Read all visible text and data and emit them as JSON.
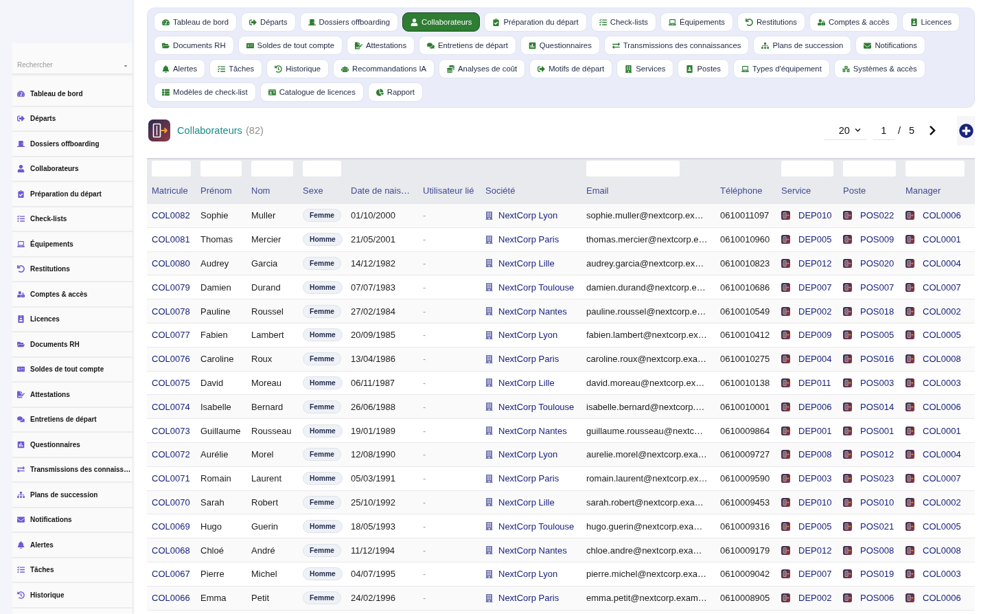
{
  "sidebar": {
    "search": {
      "placeholder": "Rechercher"
    },
    "items": [
      "Tableau de bord",
      "Départs",
      "Dossiers offboarding",
      "Collaborateurs",
      "Préparation du départ",
      "Check-lists",
      "Équipements",
      "Restitutions",
      "Comptes & accès",
      "Licences",
      "Documents RH",
      "Soldes de tout compte",
      "Attestations",
      "Entretiens de départ",
      "Questionnaires",
      "Transmissions des connaiss…",
      "Plans de succession",
      "Notifications",
      "Alertes",
      "Tâches",
      "Historique"
    ]
  },
  "tab_rows": [
    {
      "tabs": [
        {
          "label": "Tableau de bord",
          "selected": false
        },
        {
          "label": "Départs",
          "selected": false
        },
        {
          "label": "Dossiers offboarding",
          "selected": false
        },
        {
          "label": "Collaborateurs",
          "selected": true
        },
        {
          "label": "Préparation du départ",
          "selected": false
        },
        {
          "label": "Check-lists",
          "selected": false
        },
        {
          "label": "Équipements",
          "selected": false
        },
        {
          "label": "Restitutions",
          "selected": false
        },
        {
          "label": "Comptes & accès",
          "selected": false
        },
        {
          "label": "Licences",
          "selected": false
        }
      ]
    },
    {
      "tabs": [
        {
          "label": "Documents RH",
          "selected": false
        },
        {
          "label": "Soldes de tout compte",
          "selected": false
        },
        {
          "label": "Attestations",
          "selected": false
        },
        {
          "label": "Entretiens de départ",
          "selected": false
        },
        {
          "label": "Questionnaires",
          "selected": false
        },
        {
          "label": "Transmissions des connaissances",
          "selected": false
        },
        {
          "label": "Plans de succession",
          "selected": false
        },
        {
          "label": "Notifications",
          "selected": false
        }
      ]
    },
    {
      "tabs": [
        {
          "label": "Alertes",
          "selected": false
        },
        {
          "label": "Tâches",
          "selected": false
        },
        {
          "label": "Historique",
          "selected": false
        },
        {
          "label": "Recommandations IA",
          "selected": false
        },
        {
          "label": "Analyses de coût",
          "selected": false
        },
        {
          "label": "Motifs de départ",
          "selected": false
        },
        {
          "label": "Services",
          "selected": false
        },
        {
          "label": "Postes",
          "selected": false
        },
        {
          "label": "Types d'équipement",
          "selected": false
        },
        {
          "label": "Systèmes & accès",
          "selected": false
        }
      ]
    },
    {
      "tabs": [
        {
          "label": "Modèles de check-list",
          "selected": false
        },
        {
          "label": "Catalogue de licences",
          "selected": false
        },
        {
          "label": "Rapport",
          "selected": false
        }
      ]
    }
  ],
  "header": {
    "title": "Collaborateurs",
    "count": "(82)"
  },
  "pagination": {
    "page_size": "20",
    "page": "1",
    "separator": "/",
    "total_pages": "5"
  },
  "table": {
    "columns": [
      {
        "label": "Matricule",
        "kind": "link",
        "filter": true
      },
      {
        "label": "Prénom",
        "kind": "text",
        "filter": true
      },
      {
        "label": "Nom",
        "kind": "text",
        "filter": true
      },
      {
        "label": "Sexe",
        "kind": "badge",
        "filter": true
      },
      {
        "label": "Date de nais…",
        "kind": "text",
        "filter": false
      },
      {
        "label": "Utilisateur lié",
        "kind": "muted",
        "filter": false
      },
      {
        "label": "Société",
        "kind": "company",
        "filter": false
      },
      {
        "label": "Email",
        "kind": "text",
        "filter": true
      },
      {
        "label": "Téléphone",
        "kind": "text",
        "filter": false
      },
      {
        "label": "Service",
        "kind": "ref",
        "filter": true
      },
      {
        "label": "Poste",
        "kind": "ref",
        "filter": true
      },
      {
        "label": "Manager",
        "kind": "ref",
        "filter": true
      }
    ],
    "rows": [
      [
        "COL0082",
        "Sophie",
        "Muller",
        "Femme",
        "01/10/2000",
        "-",
        "NextCorp Lyon",
        "sophie.muller@nextcorp.ex…",
        "0610011097",
        "DEP010",
        "POS022",
        "COL0006"
      ],
      [
        "COL0081",
        "Thomas",
        "Mercier",
        "Homme",
        "21/05/2001",
        "-",
        "NextCorp Paris",
        "thomas.mercier@nextcorp.e…",
        "0610010960",
        "DEP005",
        "POS009",
        "COL0001"
      ],
      [
        "COL0080",
        "Audrey",
        "Garcia",
        "Femme",
        "14/12/1982",
        "-",
        "NextCorp Lille",
        "audrey.garcia@nextcorp.ex…",
        "0610010823",
        "DEP012",
        "POS020",
        "COL0004"
      ],
      [
        "COL0079",
        "Damien",
        "Durand",
        "Homme",
        "07/07/1983",
        "-",
        "NextCorp Toulouse",
        "damien.durand@nextcorp.e…",
        "0610010686",
        "DEP007",
        "POS007",
        "COL0007"
      ],
      [
        "COL0078",
        "Pauline",
        "Roussel",
        "Femme",
        "27/02/1984",
        "-",
        "NextCorp Nantes",
        "pauline.roussel@nextcorp.e…",
        "0610010549",
        "DEP002",
        "POS018",
        "COL0002"
      ],
      [
        "COL0077",
        "Fabien",
        "Lambert",
        "Homme",
        "20/09/1985",
        "-",
        "NextCorp Lyon",
        "fabien.lambert@nextcorp.ex…",
        "0610010412",
        "DEP009",
        "POS005",
        "COL0005"
      ],
      [
        "COL0076",
        "Caroline",
        "Roux",
        "Femme",
        "13/04/1986",
        "-",
        "NextCorp Paris",
        "caroline.roux@nextcorp.exa…",
        "0610010275",
        "DEP004",
        "POS016",
        "COL0008"
      ],
      [
        "COL0075",
        "David",
        "Moreau",
        "Homme",
        "06/11/1987",
        "-",
        "NextCorp Lille",
        "david.moreau@nextcorp.ex…",
        "0610010138",
        "DEP011",
        "POS003",
        "COL0003"
      ],
      [
        "COL0074",
        "Isabelle",
        "Bernard",
        "Femme",
        "26/06/1988",
        "-",
        "NextCorp Toulouse",
        "isabelle.bernard@nextcorp.…",
        "0610010001",
        "DEP006",
        "POS014",
        "COL0006"
      ],
      [
        "COL0073",
        "Guillaume",
        "Rousseau",
        "Homme",
        "19/01/1989",
        "-",
        "NextCorp Nantes",
        "guillaume.rousseau@nextc…",
        "0610009864",
        "DEP001",
        "POS001",
        "COL0001"
      ],
      [
        "COL0072",
        "Aurélie",
        "Morel",
        "Femme",
        "12/08/1990",
        "-",
        "NextCorp Lyon",
        "aurelie.morel@nextcorp.exa…",
        "0610009727",
        "DEP008",
        "POS012",
        "COL0004"
      ],
      [
        "COL0071",
        "Romain",
        "Laurent",
        "Homme",
        "05/03/1991",
        "-",
        "NextCorp Paris",
        "romain.laurent@nextcorp.ex…",
        "0610009590",
        "DEP003",
        "POS023",
        "COL0007"
      ],
      [
        "COL0070",
        "Sarah",
        "Robert",
        "Femme",
        "25/10/1992",
        "-",
        "NextCorp Lille",
        "sarah.robert@nextcorp.exa…",
        "0610009453",
        "DEP010",
        "POS010",
        "COL0002"
      ],
      [
        "COL0069",
        "Hugo",
        "Guerin",
        "Homme",
        "18/05/1993",
        "-",
        "NextCorp Toulouse",
        "hugo.guerin@nextcorp.exa…",
        "0610009316",
        "DEP005",
        "POS021",
        "COL0005"
      ],
      [
        "COL0068",
        "Chloé",
        "André",
        "Femme",
        "11/12/1994",
        "-",
        "NextCorp Nantes",
        "chloe.andre@nextcorp.exa…",
        "0610009179",
        "DEP012",
        "POS008",
        "COL0008"
      ],
      [
        "COL0067",
        "Pierre",
        "Michel",
        "Homme",
        "04/07/1995",
        "-",
        "NextCorp Lyon",
        "pierre.michel@nextcorp.exa…",
        "0610009042",
        "DEP007",
        "POS019",
        "COL0003"
      ],
      [
        "COL0066",
        "Emma",
        "Petit",
        "Femme",
        "24/02/1996",
        "-",
        "NextCorp Paris",
        "emma.petit@nextcorp.exam…",
        "0610008905",
        "DEP002",
        "POS006",
        "COL0006"
      ]
    ]
  }
}
